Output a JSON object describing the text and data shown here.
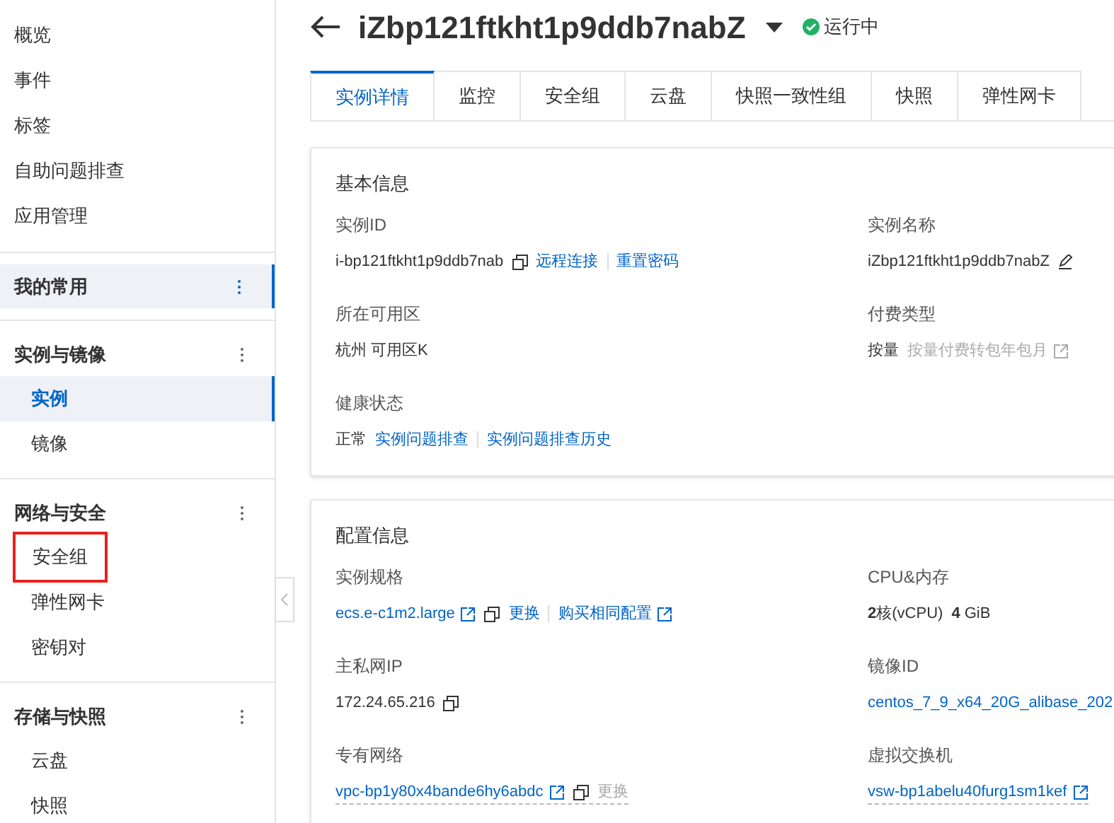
{
  "sidebar": {
    "top_items": [
      {
        "label": "概览",
        "selected": false
      },
      {
        "label": "事件",
        "selected": false
      },
      {
        "label": "标签",
        "selected": false
      },
      {
        "label": "自助问题排查",
        "selected": false
      },
      {
        "label": "应用管理",
        "selected": false
      }
    ],
    "groups": [
      {
        "label": "我的常用",
        "selected": true
      },
      {
        "label": "实例与镜像",
        "selected": false,
        "items": [
          {
            "label": "实例",
            "selected": true,
            "marked": false
          },
          {
            "label": "镜像",
            "selected": false,
            "marked": false
          }
        ]
      },
      {
        "label": "网络与安全",
        "selected": false,
        "items": [
          {
            "label": "安全组",
            "selected": false,
            "marked": true
          },
          {
            "label": "弹性网卡",
            "selected": false,
            "marked": false
          },
          {
            "label": "密钥对",
            "selected": false,
            "marked": false
          }
        ]
      },
      {
        "label": "存储与快照",
        "selected": false,
        "items": [
          {
            "label": "云盘",
            "selected": false,
            "marked": false
          },
          {
            "label": "快照",
            "selected": false,
            "marked": false
          }
        ]
      }
    ]
  },
  "header": {
    "title": "iZbp121ftkht1p9ddb7nabZ",
    "status": "运行中"
  },
  "tabs": [
    {
      "label": "实例详情",
      "selected": true
    },
    {
      "label": "监控",
      "selected": false
    },
    {
      "label": "安全组",
      "selected": false
    },
    {
      "label": "云盘",
      "selected": false
    },
    {
      "label": "快照一致性组",
      "selected": false
    },
    {
      "label": "快照",
      "selected": false
    },
    {
      "label": "弹性网卡",
      "selected": false
    }
  ],
  "cards": [
    {
      "title": "基本信息",
      "fields": [
        {
          "label": "实例ID",
          "underlined": false,
          "items": [
            {
              "kind": "text",
              "text": "i-bp121ftkht1p9ddb7nab"
            },
            {
              "kind": "copy"
            },
            {
              "kind": "link",
              "text": "远程连接",
              "disabled": false
            },
            {
              "kind": "divider"
            },
            {
              "kind": "link",
              "text": "重置密码",
              "disabled": false
            }
          ]
        },
        {
          "label": "实例名称",
          "underlined": false,
          "items": [
            {
              "kind": "text",
              "text": "iZbp121ftkht1p9ddb7nabZ"
            },
            {
              "kind": "edit"
            }
          ]
        },
        {
          "label": "所在可用区",
          "underlined": false,
          "items": [
            {
              "kind": "text",
              "text": "杭州 可用区K"
            }
          ]
        },
        {
          "label": "付费类型",
          "underlined": false,
          "items": [
            {
              "kind": "text",
              "text": "按量"
            },
            {
              "kind": "link",
              "text": "按量付费转包年包月",
              "disabled": true
            },
            {
              "kind": "external",
              "disabled": true
            }
          ]
        },
        {
          "label": "健康状态",
          "underlined": false,
          "items": [
            {
              "kind": "text",
              "text": "正常"
            },
            {
              "kind": "link",
              "text": "实例问题排查",
              "disabled": false
            },
            {
              "kind": "divider"
            },
            {
              "kind": "link",
              "text": "实例问题排查历史",
              "disabled": false
            }
          ]
        }
      ]
    },
    {
      "title": "配置信息",
      "fields": [
        {
          "label": "实例规格",
          "underlined": false,
          "items": [
            {
              "kind": "link",
              "text": "ecs.e-c1m2.large",
              "disabled": false
            },
            {
              "kind": "external",
              "disabled": false
            },
            {
              "kind": "copy"
            },
            {
              "kind": "link",
              "text": "更换",
              "disabled": false
            },
            {
              "kind": "divider"
            },
            {
              "kind": "link",
              "text": "购买相同配置",
              "disabled": false
            },
            {
              "kind": "external",
              "disabled": false
            }
          ]
        },
        {
          "label": "CPU&内存",
          "underlined": false,
          "items": [
            {
              "kind": "text",
              "text": "**2**核(vCPU)"
            },
            {
              "kind": "text",
              "text": "**4** GiB"
            }
          ]
        },
        {
          "label": "主私网IP",
          "underlined": false,
          "items": [
            {
              "kind": "text",
              "text": "172.24.65.216"
            },
            {
              "kind": "copy"
            }
          ]
        },
        {
          "label": "镜像ID",
          "underlined": false,
          "items": [
            {
              "kind": "link",
              "text": "centos_7_9_x64_20G_alibase_202",
              "disabled": false
            }
          ]
        },
        {
          "label": "专有网络",
          "underlined": true,
          "items": [
            {
              "kind": "link",
              "text": "vpc-bp1y80x4bande6hy6abdc",
              "disabled": false
            },
            {
              "kind": "external",
              "disabled": false
            },
            {
              "kind": "copy"
            },
            {
              "kind": "link",
              "text": "更换",
              "disabled": true
            }
          ]
        },
        {
          "label": "虚拟交换机",
          "underlined": true,
          "items": [
            {
              "kind": "link",
              "text": "vsw-bp1abelu40furg1sm1kef",
              "disabled": false
            },
            {
              "kind": "external",
              "disabled": false
            }
          ]
        }
      ]
    }
  ]
}
